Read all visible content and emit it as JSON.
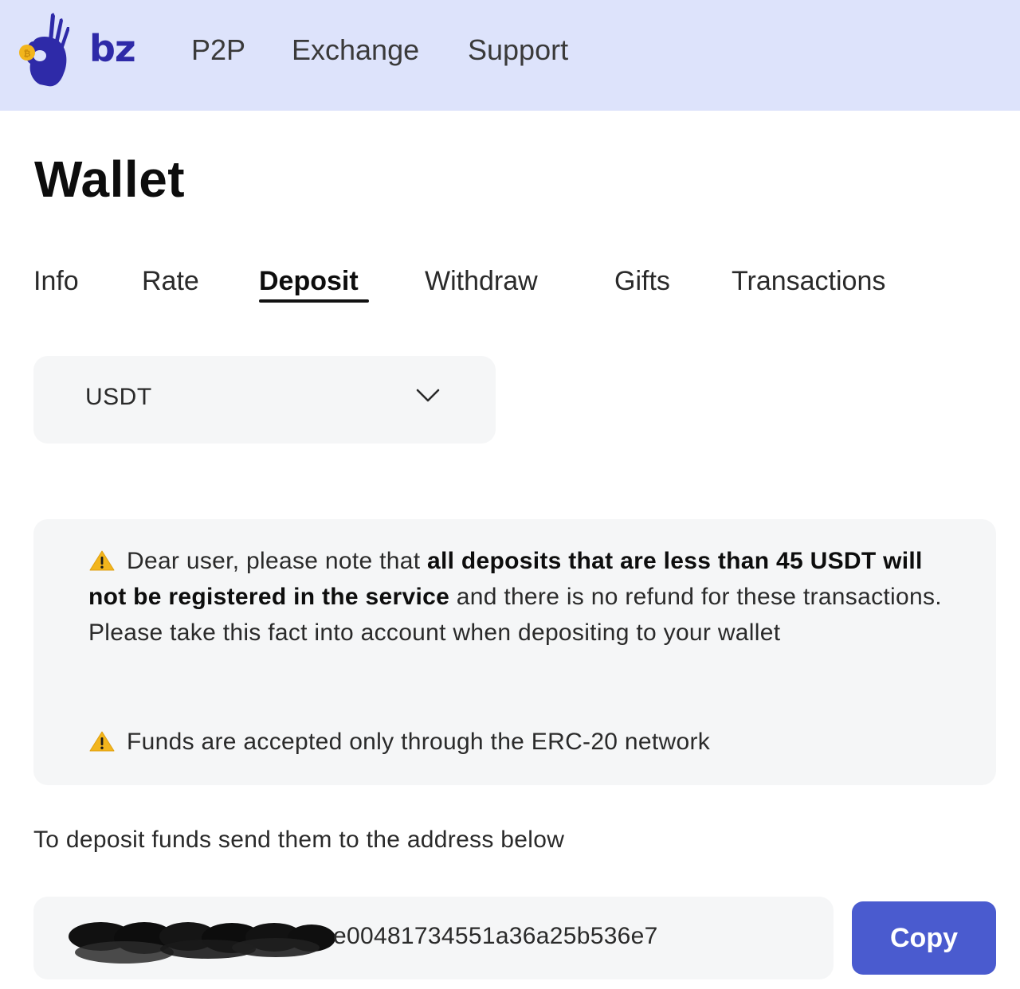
{
  "brand": {
    "logo_text": "bz",
    "accent_color": "#2e2aa8",
    "coin_color": "#f2b51c"
  },
  "nav": {
    "items": [
      "P2P",
      "Exchange",
      "Support"
    ]
  },
  "page": {
    "title": "Wallet"
  },
  "tabs": {
    "items": [
      "Info",
      "Rate",
      "Deposit",
      "Withdraw",
      "Gifts",
      "Transactions"
    ],
    "active": "Deposit"
  },
  "currency_select": {
    "selected": "USDT",
    "icon": "chevron-down-icon"
  },
  "notice": {
    "icon": "warning-icon",
    "p1_pre": "Dear user, please note that ",
    "p1_bold": "all deposits that are less than 45 USDT will not be registered in the service",
    "p1_post": " and there is no refund for these transactions. Please take this fact into account when depositing to your wallet",
    "p2": "Funds are accepted only through the ERC-20 network"
  },
  "deposit": {
    "instructions": "To deposit funds send them to the address below",
    "address_visible": "e00481734551a36a25b536e7",
    "copy_label": "Copy",
    "button_color": "#4a5bcf"
  }
}
